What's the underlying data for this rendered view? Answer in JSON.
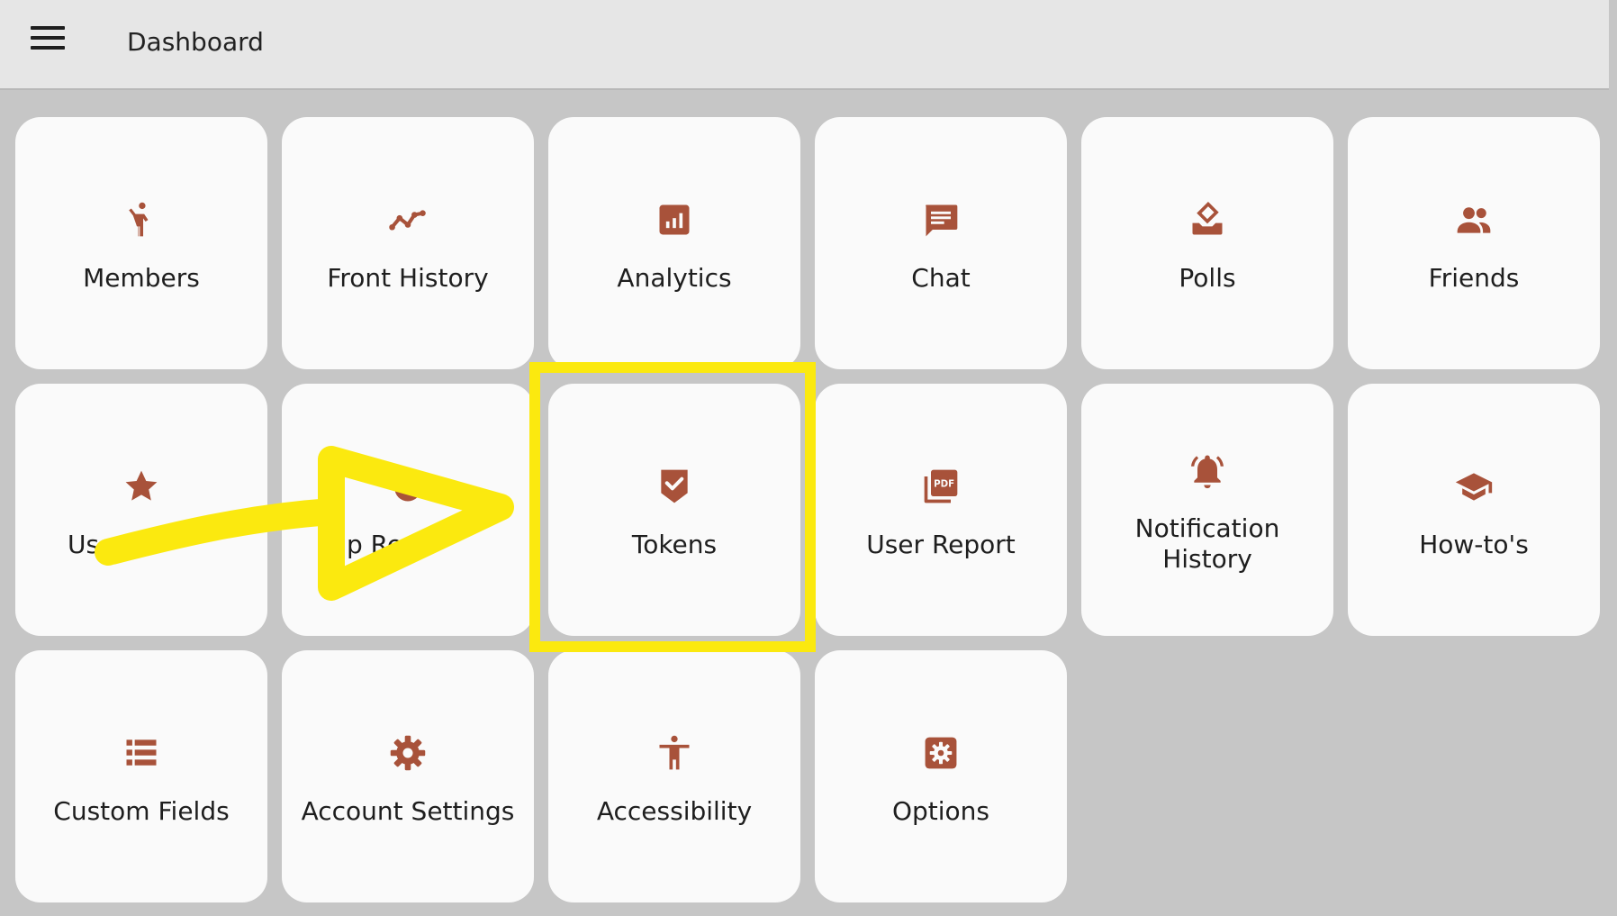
{
  "header": {
    "title": "Dashboard"
  },
  "accent_color": "#a8523a",
  "annotation_color": "#fbe90f",
  "tiles": [
    {
      "label": "Members",
      "icon": "person-raising-hand-icon"
    },
    {
      "label": "Front History",
      "icon": "line-chart-icon"
    },
    {
      "label": "Analytics",
      "icon": "analytics-icon"
    },
    {
      "label": "Chat",
      "icon": "chat-icon"
    },
    {
      "label": "Polls",
      "icon": "ballot-box-icon"
    },
    {
      "label": "Friends",
      "icon": "people-icon"
    },
    {
      "label": "Us",
      "icon": "star-icon"
    },
    {
      "label": "p Re",
      "icon": "reminder-icon"
    },
    {
      "label": "Tokens",
      "icon": "shield-check-icon"
    },
    {
      "label": "User Report",
      "icon": "pdf-icon"
    },
    {
      "label": "Notification History",
      "icon": "bell-ringing-icon"
    },
    {
      "label": "How-to's",
      "icon": "graduation-cap-icon"
    },
    {
      "label": "Custom Fields",
      "icon": "list-icon"
    },
    {
      "label": "Account Settings",
      "icon": "gear-icon"
    },
    {
      "label": "Accessibility",
      "icon": "accessibility-icon"
    },
    {
      "label": "Options",
      "icon": "settings-box-icon"
    }
  ]
}
